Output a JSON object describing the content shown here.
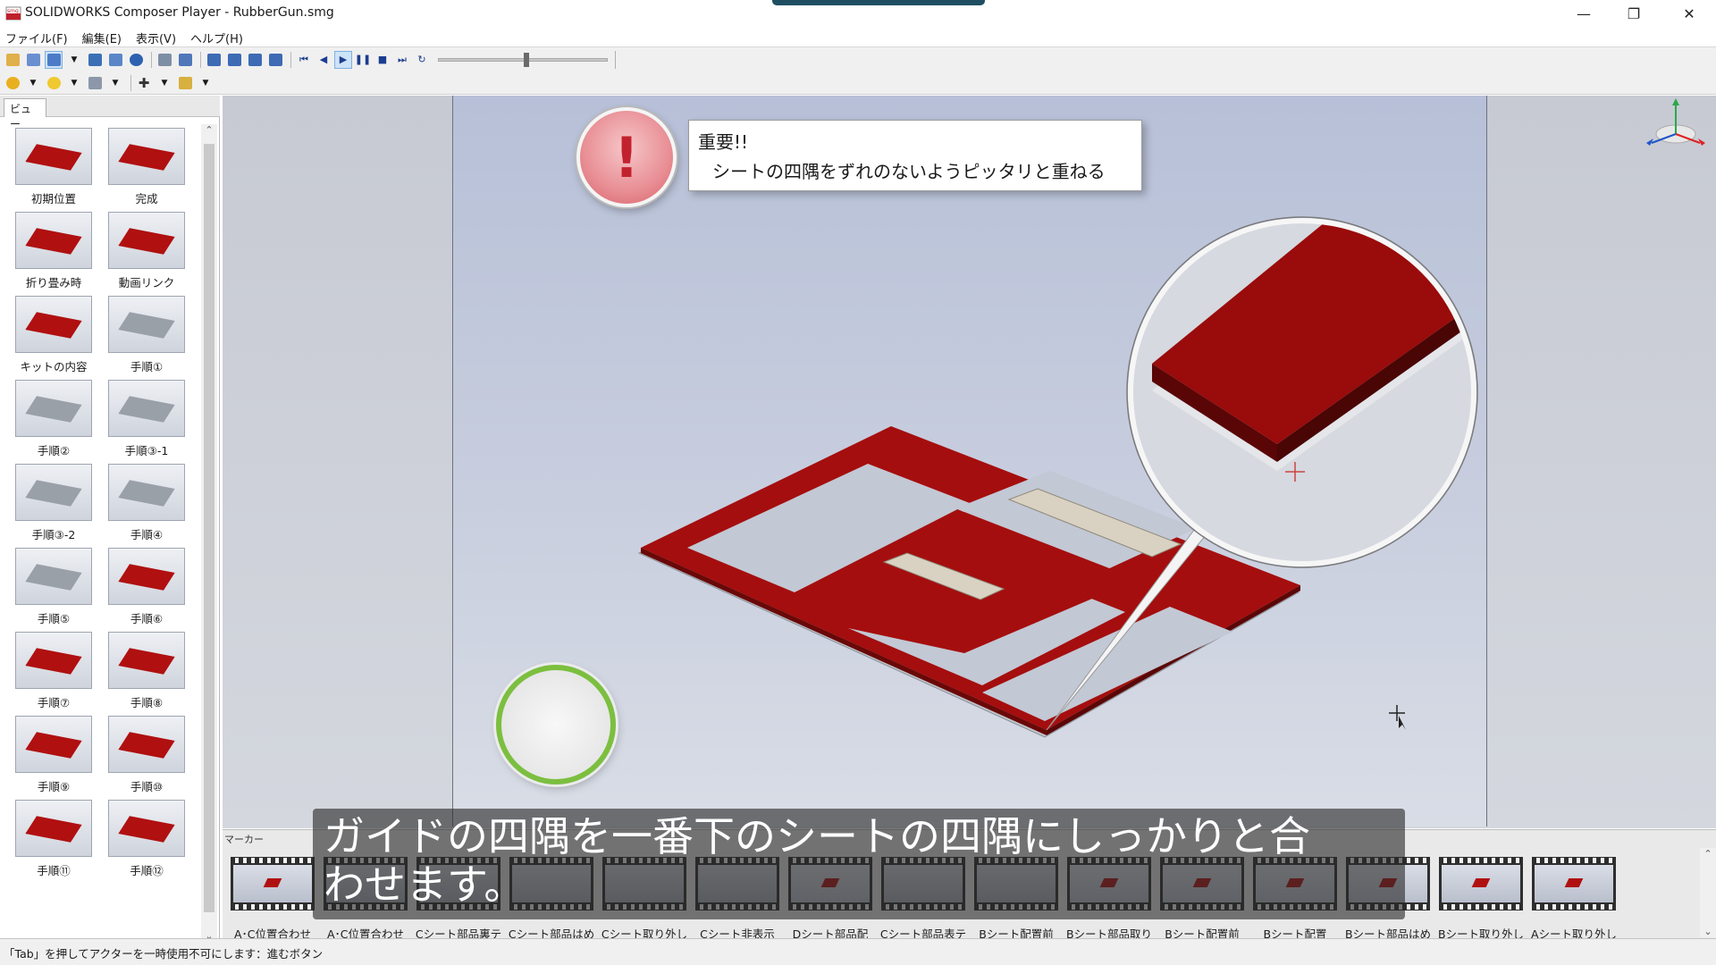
{
  "window": {
    "title": "SOLIDWORKS Composer Player - RubberGun.smg",
    "icon": "smg-app-icon",
    "controls": [
      "minimize-icon",
      "restore-icon",
      "close-icon"
    ]
  },
  "menu": [
    "ファイル(F)",
    "編集(E)",
    "表示(V)",
    "ヘルプ(H)"
  ],
  "panel": {
    "tab_label": "ビュー",
    "views": [
      {
        "label": "初期位置",
        "style": "red"
      },
      {
        "label": "完成",
        "style": "red"
      },
      {
        "label": "折り畳み時",
        "style": "red"
      },
      {
        "label": "動画リンク",
        "style": "red"
      },
      {
        "label": "キットの内容",
        "style": "red"
      },
      {
        "label": "手順①",
        "style": "gray"
      },
      {
        "label": "手順②",
        "style": "gray"
      },
      {
        "label": "手順③-1",
        "style": "gray"
      },
      {
        "label": "手順③-2",
        "style": "gray"
      },
      {
        "label": "手順④",
        "style": "gray"
      },
      {
        "label": "手順⑤",
        "style": "gray"
      },
      {
        "label": "手順⑥",
        "style": "red"
      },
      {
        "label": "手順⑦",
        "style": "red"
      },
      {
        "label": "手順⑧",
        "style": "red"
      },
      {
        "label": "手順⑨",
        "style": "red"
      },
      {
        "label": "手順⑩",
        "style": "red"
      },
      {
        "label": "手順⑪",
        "style": "red"
      },
      {
        "label": "手順⑫",
        "style": "red"
      }
    ]
  },
  "viewport": {
    "callout_title": "重要!!",
    "callout_body": "シートの四隅をずれのないようピッタリと重ねる",
    "warning_symbol": "!"
  },
  "subtitle": {
    "line1": "ガイドの四隅を一番下のシートの四隅にしっかりと合",
    "line2": "わせます。"
  },
  "markers": {
    "header": "マーカー",
    "items": [
      {
        "label": "A･C位置合わせ",
        "style": "red"
      },
      {
        "label": "A･C位置合わせ",
        "style": "plain"
      },
      {
        "label": "Cシート部品裏テ",
        "style": "plain"
      },
      {
        "label": "Cシート部品はめ",
        "style": "plain"
      },
      {
        "label": "Cシート取り外し",
        "style": "plain"
      },
      {
        "label": "Cシート非表示",
        "style": "plain"
      },
      {
        "label": "Dシート部品配",
        "style": "red"
      },
      {
        "label": "Cシート部品表テ",
        "style": "plain"
      },
      {
        "label": "Bシート配置前",
        "style": "plain"
      },
      {
        "label": "Bシート部品取り",
        "style": "red"
      },
      {
        "label": "Bシート配置前",
        "style": "red"
      },
      {
        "label": "Bシート配置",
        "style": "red"
      },
      {
        "label": "Bシート部品はめ",
        "style": "red"
      },
      {
        "label": "Bシート取り外し",
        "style": "red"
      },
      {
        "label": "Aシート取り外し",
        "style": "red"
      }
    ]
  },
  "status": {
    "text": "「Tab」を押してアクターを一時使用不可にします：進むボタン"
  },
  "colors": {
    "accent_red": "#b01010",
    "back_button_green": "#7cbf3f",
    "warning_red": "#c2222e"
  },
  "playback": {
    "position": 0.52
  }
}
